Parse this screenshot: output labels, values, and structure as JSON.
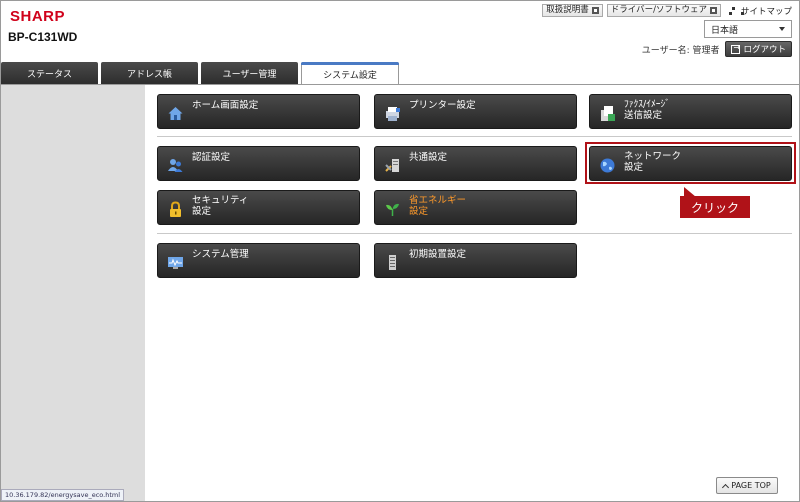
{
  "header": {
    "brand": "SHARP",
    "model": "BP-C131WD",
    "links": [
      "取扱説明書",
      "ドライバー/ソフトウェア"
    ],
    "sitemap": "サイトマップ",
    "language": "日本語",
    "user_label": "ユーザー名: 管理者",
    "logout": "ログアウト"
  },
  "tabs": [
    {
      "label": "ステータス",
      "active": false
    },
    {
      "label": "アドレス帳",
      "active": false
    },
    {
      "label": "ユーザー管理",
      "active": false
    },
    {
      "label": "システム設定",
      "active": true
    }
  ],
  "menu": {
    "home": {
      "label": "ホーム画面設定",
      "icon": "home-icon"
    },
    "printer": {
      "label": "プリンター設定",
      "icon": "printer-icon"
    },
    "fax1": "ﾌｧｸｽ/ｲﾒｰｼﾞ",
    "fax2": "送信設定",
    "auth": {
      "label": "認証設定",
      "icon": "users-icon"
    },
    "common": {
      "label": "共通設定",
      "icon": "tools-icon"
    },
    "network1": "ネットワーク",
    "network2": "設定",
    "security1": "セキュリティ",
    "security2": "設定",
    "energy1": "省エネルギー",
    "energy2": "設定",
    "sysmgmt": {
      "label": "システム管理",
      "icon": "monitor-icon"
    },
    "initial": {
      "label": "初期設置設定",
      "icon": "device-icon"
    }
  },
  "callout": "クリック",
  "page_top": "PAGE TOP",
  "status_bar": "10.36.179.82/energysave_eco.html",
  "colors": {
    "accent_red": "#b01218",
    "brand_red": "#d0021b",
    "energy_orange": "#ff9a2a"
  }
}
